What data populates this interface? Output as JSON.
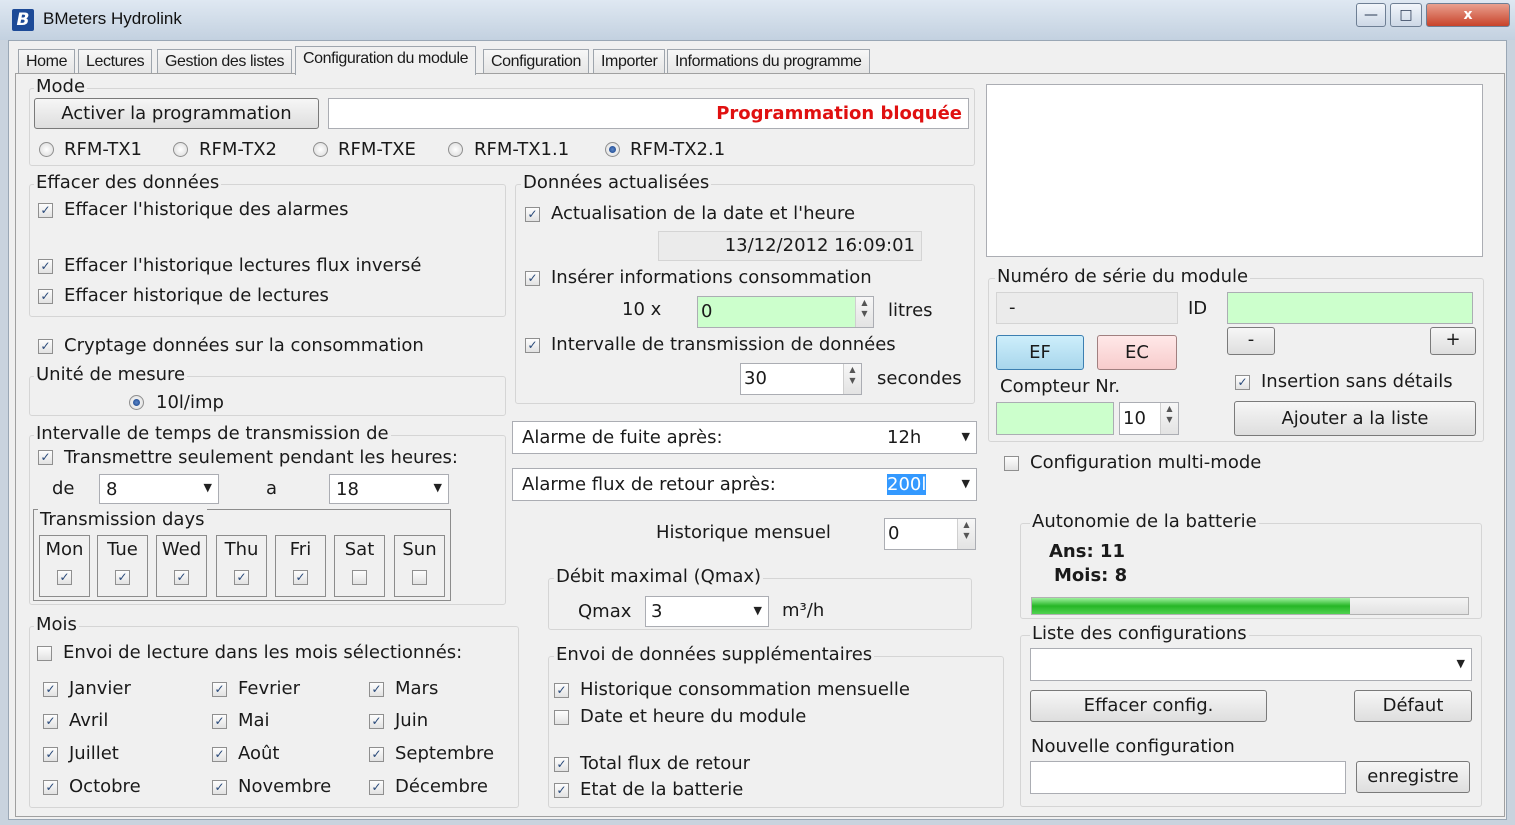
{
  "window": {
    "title": "BMeters Hydrolink",
    "app_icon": "B",
    "min": "—",
    "max": "□",
    "close": "x"
  },
  "tabs": [
    "Home",
    "Lectures",
    "Gestion des listes",
    "Configuration du module",
    "Configuration",
    "Importer",
    "Informations du programme"
  ],
  "mode": {
    "title": "Mode",
    "activate_button": "Activer la programmation",
    "status_text": "Programmation bloquée",
    "status_color": "#e01010",
    "radios": [
      "RFM-TX1",
      "RFM-TX2",
      "RFM-TXE",
      "RFM-TX1.1",
      "RFM-TX2.1"
    ],
    "selected": "RFM-TX2.1"
  },
  "effacer": {
    "title": "Effacer des données",
    "alarmes": "Effacer l'historique des alarmes",
    "flux_inverse": "Effacer l'historique lectures flux inversé",
    "lectures": "Effacer historique de lectures"
  },
  "cryptage": "Cryptage données sur la consommation",
  "unite": {
    "title": "Unité de mesure",
    "option": "10l/imp"
  },
  "intervalle_temps": {
    "title": "Intervalle de temps de transmission de",
    "heures": "Transmettre seulement pendant les heures:",
    "de_label": "de",
    "de_value": "8",
    "a_label": "a",
    "a_value": "18"
  },
  "transmission_days": {
    "title": "Transmission days",
    "days": [
      {
        "label": "Mon",
        "checked": true
      },
      {
        "label": "Tue",
        "checked": true
      },
      {
        "label": "Wed",
        "checked": true
      },
      {
        "label": "Thu",
        "checked": true
      },
      {
        "label": "Fri",
        "checked": true
      },
      {
        "label": "Sat",
        "checked": false
      },
      {
        "label": "Sun",
        "checked": false
      }
    ]
  },
  "mois": {
    "title": "Mois",
    "envoi": "Envoi de lecture dans les mois sélectionnés:",
    "months": [
      "Janvier",
      "Fevrier",
      "Mars",
      "Avril",
      "Mai",
      "Juin",
      "Juillet",
      "Août",
      "Septembre",
      "Octobre",
      "Novembre",
      "Décembre"
    ]
  },
  "donnees": {
    "title": "Données actualisées",
    "actualisation": "Actualisation de la date et l'heure",
    "datetime": "13/12/2012 16:09:01",
    "inserer": "Insérer informations consommation",
    "multiplier": "10 x",
    "litres_value": "0",
    "litres_label": "litres",
    "intervalle": "Intervalle de transmission de données",
    "secondes_value": "30",
    "secondes_label": "secondes"
  },
  "alarmes": {
    "fuite_label": "Alarme de fuite après:",
    "fuite_value": "12h",
    "flux_label": "Alarme flux de retour après:",
    "flux_value": "200l"
  },
  "historique": {
    "label": "Historique mensuel",
    "value": "0"
  },
  "qmax": {
    "title": "Débit maximal (Qmax)",
    "label": "Qmax",
    "value": "3",
    "unit": "m³/h"
  },
  "envoi_sup": {
    "title": "Envoi de données supplémentaires",
    "items": [
      {
        "label": "Historique consommation mensuelle",
        "checked": true
      },
      {
        "label": "Date et heure du module",
        "checked": false
      },
      {
        "label": "Total flux de retour",
        "checked": true
      },
      {
        "label": "Etat de la batterie",
        "checked": true
      }
    ]
  },
  "serie": {
    "title": "Numéro de série du module",
    "value": "-",
    "id_label": "ID",
    "id_value": "",
    "ef": "EF",
    "ec": "EC",
    "minus": "-",
    "plus": "+",
    "compteur_label": "Compteur Nr.",
    "compteur_value": "",
    "count_value": "10",
    "insertion": "Insertion sans détails",
    "ajouter": "Ajouter a la liste"
  },
  "multimode": "Configuration multi-mode",
  "batterie": {
    "title": "Autonomie de la batterie",
    "ans": "Ans: 11",
    "mois": "Mois: 8",
    "level": 0.73
  },
  "configs": {
    "title": "Liste des configurations",
    "selected": "",
    "effacer": "Effacer config.",
    "defaut": "Défaut",
    "nouvelle_label": "Nouvelle configuration",
    "nouvelle_value": "",
    "enregistre": "enregistre"
  }
}
